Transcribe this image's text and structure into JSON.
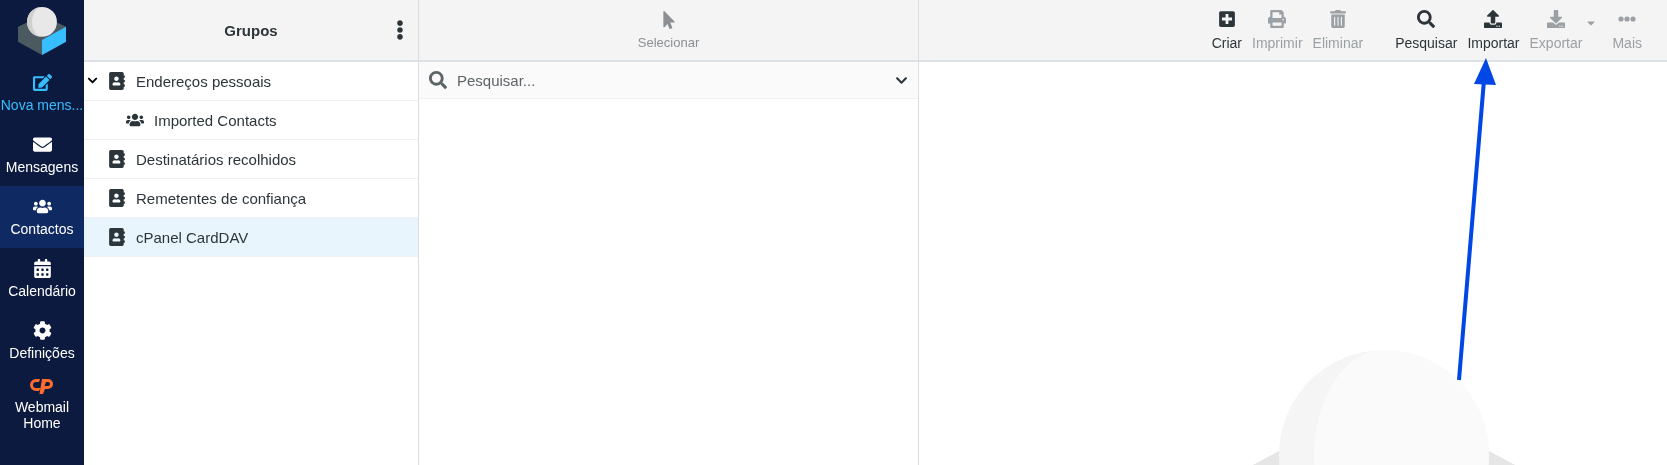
{
  "sidebar": {
    "items": [
      {
        "label": "Nova mens...",
        "kind": "compose",
        "selected": false
      },
      {
        "label": "Mensagens",
        "kind": "nav",
        "selected": false
      },
      {
        "label": "Contactos",
        "kind": "nav",
        "selected": true
      },
      {
        "label": "Calendário",
        "kind": "nav",
        "selected": false
      },
      {
        "label": "Definições",
        "kind": "nav",
        "selected": false
      },
      {
        "label": "Webmail Home",
        "kind": "cpanel",
        "selected": false
      }
    ]
  },
  "groups": {
    "title": "Grupos",
    "items": [
      {
        "label": "Endereços pessoais",
        "selected": false,
        "expanded": true,
        "children": [
          {
            "label": "Imported Contacts",
            "selected": false
          }
        ]
      },
      {
        "label": "Destinatários recolhidos",
        "selected": false
      },
      {
        "label": "Remetentes de confiança",
        "selected": false
      },
      {
        "label": "cPanel CardDAV",
        "selected": true
      }
    ]
  },
  "list": {
    "select_label": "Selecionar",
    "search": {
      "placeholder": "Pesquisar..."
    }
  },
  "toolbar": [
    {
      "label": "Criar",
      "disabled": false
    },
    {
      "label": "Imprimir",
      "disabled": true
    },
    {
      "label": "Eliminar",
      "disabled": true
    },
    {
      "label": "Pesquisar",
      "disabled": false
    },
    {
      "label": "Importar",
      "disabled": false
    },
    {
      "label": "Exportar",
      "disabled": true,
      "dropdown": true
    },
    {
      "label": "Mais",
      "disabled": true
    }
  ]
}
